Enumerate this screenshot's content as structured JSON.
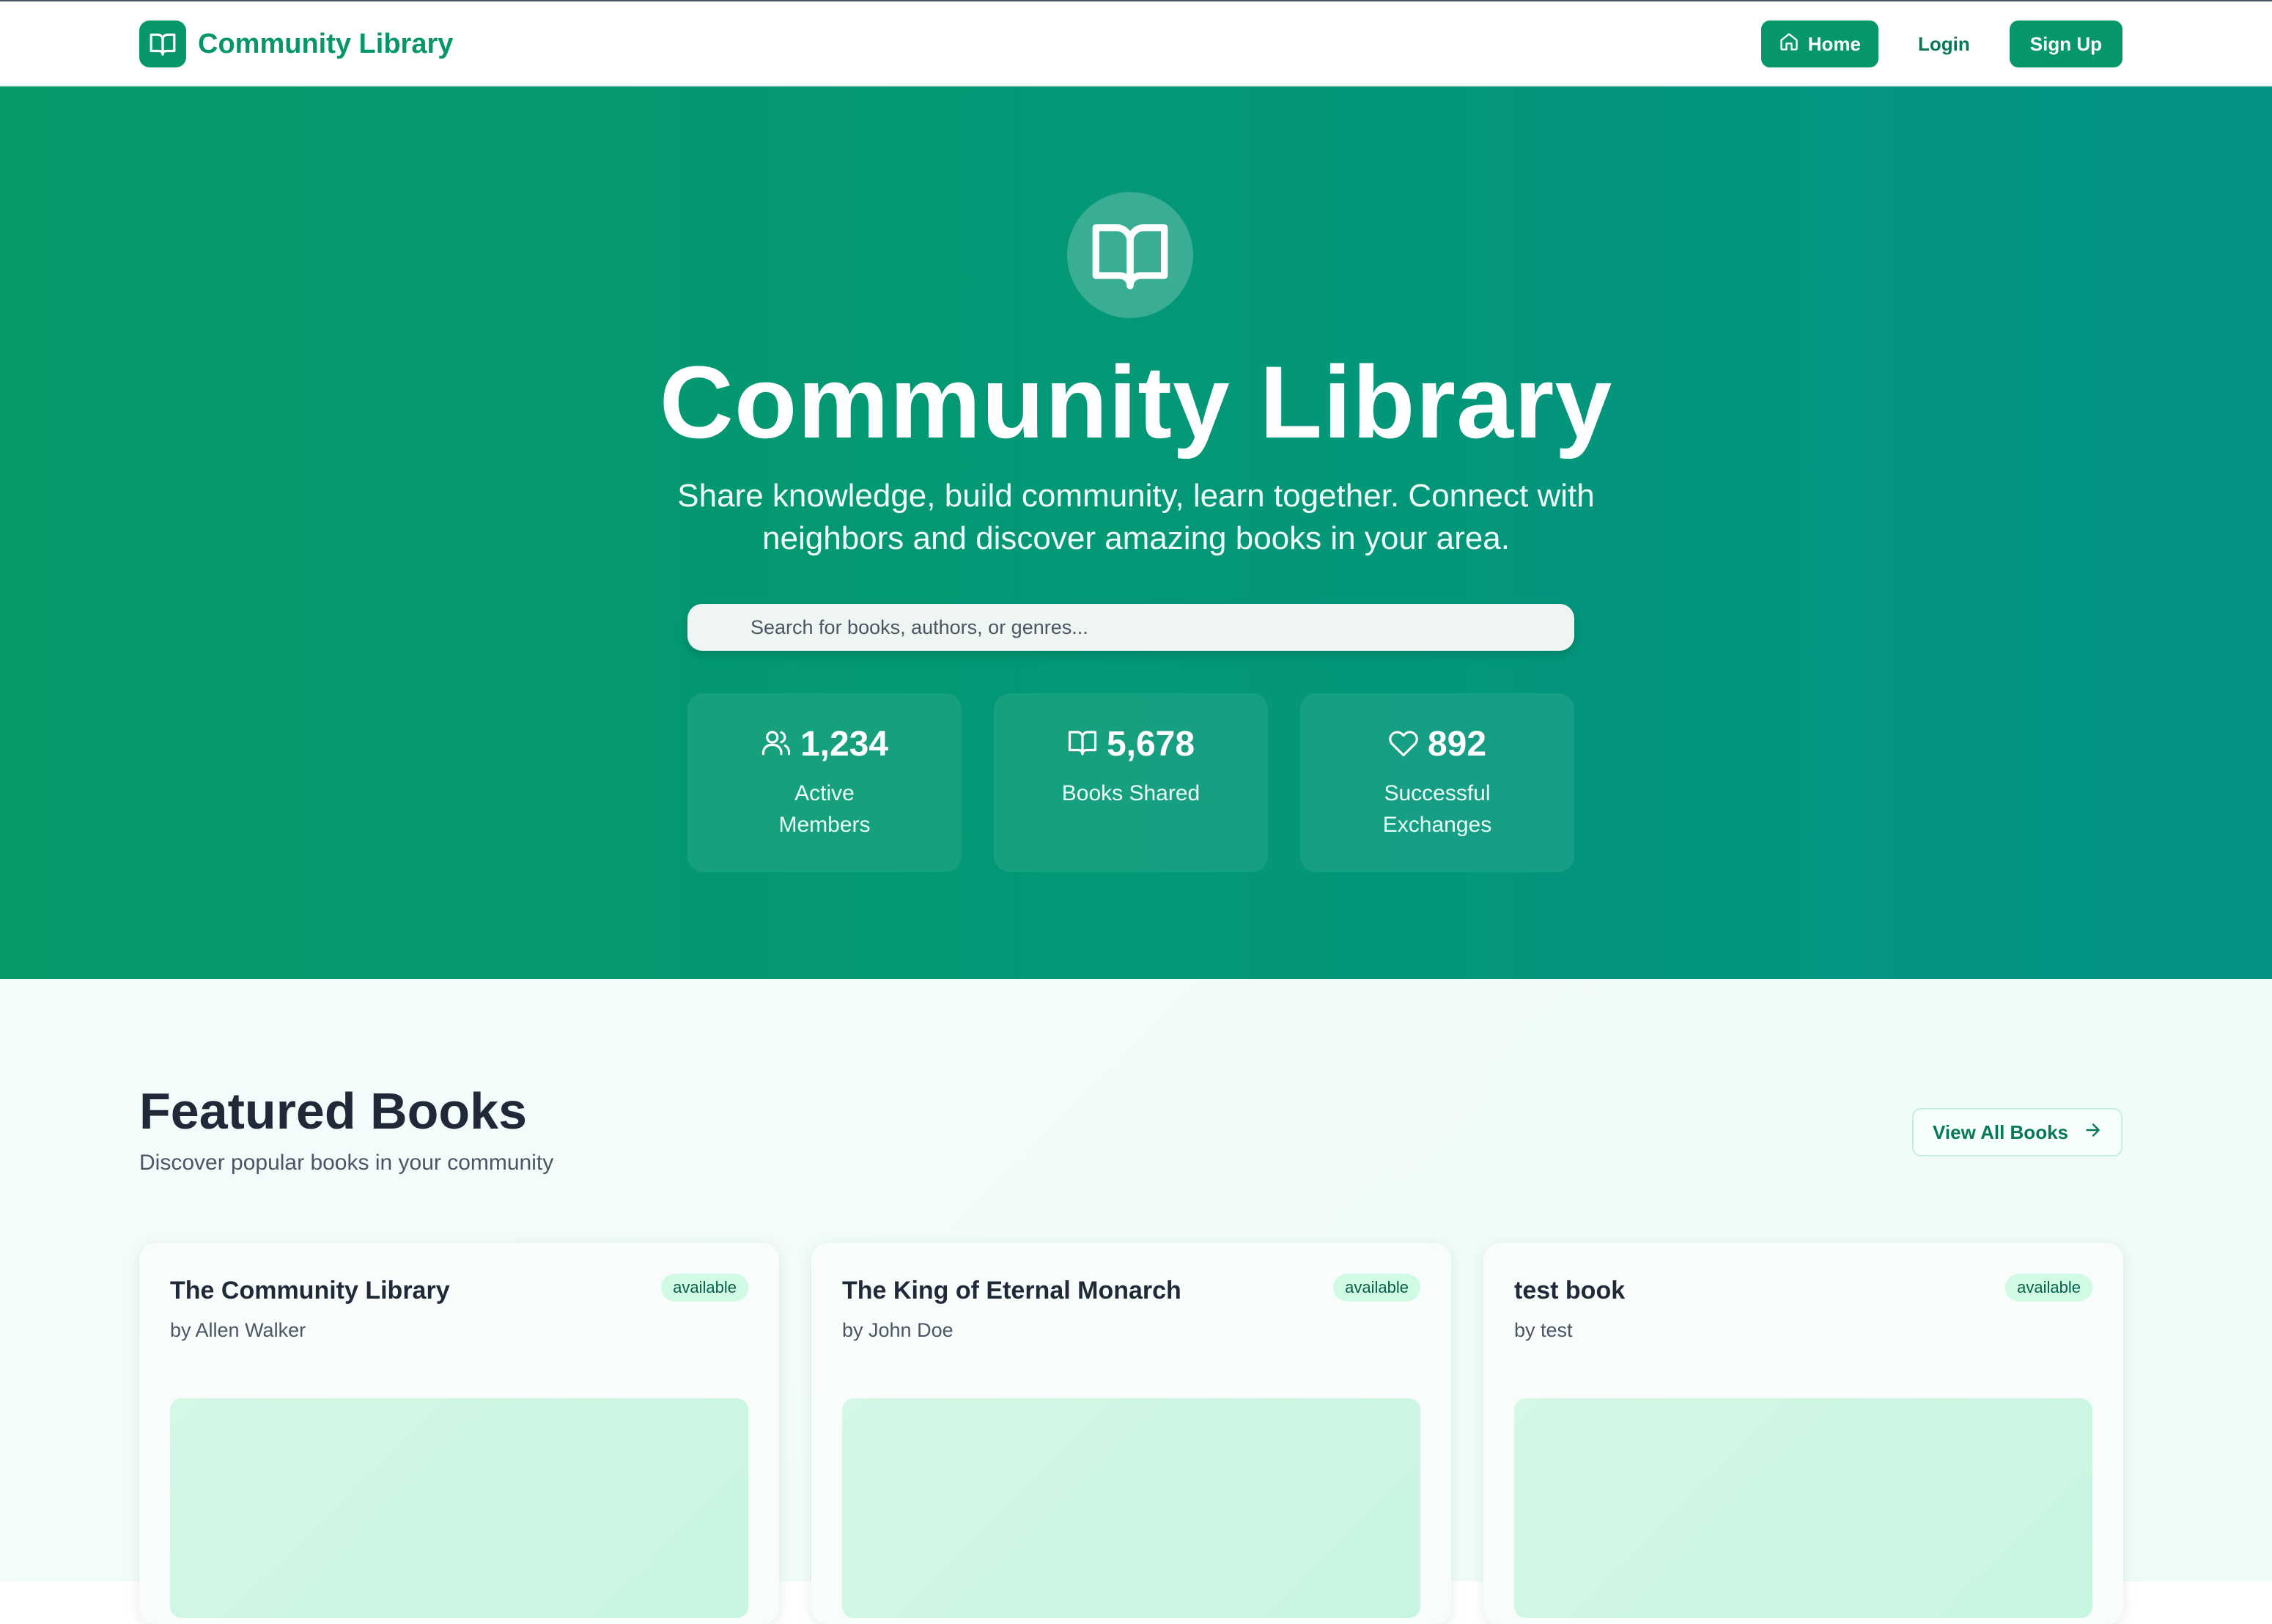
{
  "nav": {
    "brand": "Community Library",
    "home_label": "Home",
    "login_label": "Login",
    "signup_label": "Sign Up",
    "icons": {
      "brand": "book-open-icon",
      "home": "home-icon"
    }
  },
  "hero": {
    "title": "Community Library",
    "subtitle": "Share knowledge, build community, learn together. Connect with neighbors and discover amazing books in your area.",
    "search_placeholder": "Search for books, authors, or genres...",
    "icon": "book-open-icon",
    "stats": [
      {
        "icon": "users-icon",
        "value": "1,234",
        "label": "Active Members"
      },
      {
        "icon": "book-open-icon",
        "value": "5,678",
        "label": "Books Shared"
      },
      {
        "icon": "heart-icon",
        "value": "892",
        "label": "Successful Exchanges"
      }
    ]
  },
  "featured": {
    "title": "Featured Books",
    "subtitle": "Discover popular books in your community",
    "view_all_label": "View All Books",
    "view_all_icon": "arrow-right-icon",
    "books": [
      {
        "title": "The Community Library",
        "author": "by Allen Walker",
        "status": "available"
      },
      {
        "title": "The King of Eternal Monarch",
        "author": "by John Doe",
        "status": "available"
      },
      {
        "title": "test book",
        "author": "by test",
        "status": "available"
      }
    ]
  },
  "colors": {
    "brand": "#059669",
    "brand_dark": "#047857",
    "hero_gradient_start": "#049a6a",
    "hero_gradient_end": "#039486",
    "badge_bg": "#d1fae5",
    "badge_text": "#065f46"
  }
}
